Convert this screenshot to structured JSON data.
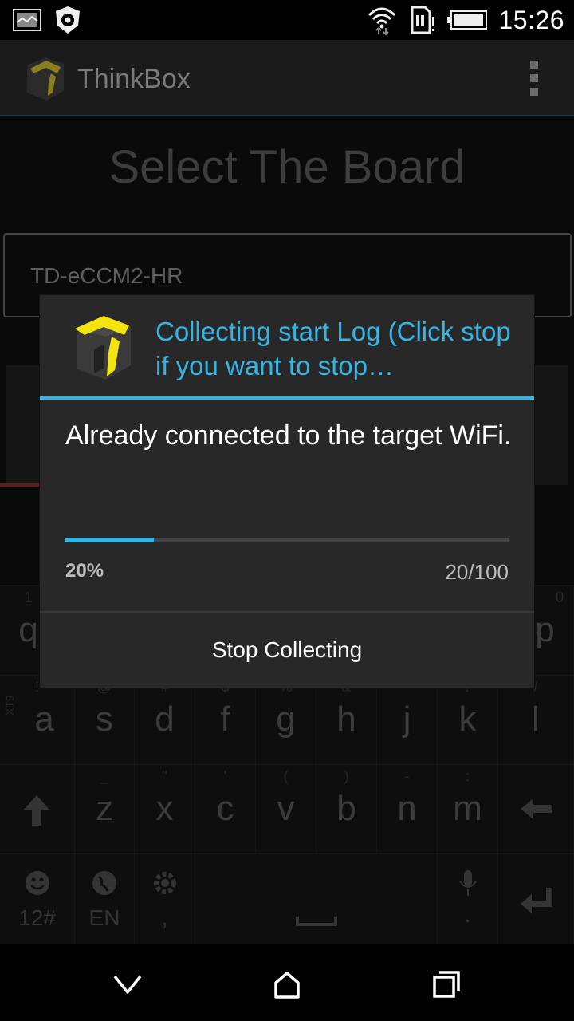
{
  "status_bar": {
    "time": "15:26",
    "left_icons": [
      "image-icon",
      "settings-notification-icon"
    ],
    "right_icons": [
      "wifi-icon",
      "sim-alert-icon",
      "battery-icon"
    ]
  },
  "action_bar": {
    "title": "ThinkBox",
    "overflow_icon": "overflow-menu-icon"
  },
  "background": {
    "page_title": "Select The Board",
    "board_value": "TD-eCCM2-HR"
  },
  "dialog": {
    "title": "Collecting start Log (Click stop if you want to stop…",
    "message": "Already connected to the target WiFi.",
    "progress_fraction": 0.2,
    "progress_percent": "20%",
    "progress_count": "20/100",
    "button_label": "Stop Collecting",
    "accent_color": "#33b5e5"
  },
  "keyboard": {
    "row1_visible": [
      {
        "ch": "q",
        "hint": "1"
      },
      {
        "ch": "p",
        "hint": "0"
      }
    ],
    "row2": [
      {
        "ch": "a",
        "hint": "!"
      },
      {
        "ch": "s",
        "hint": "@"
      },
      {
        "ch": "d",
        "hint": "#"
      },
      {
        "ch": "f",
        "hint": "$"
      },
      {
        "ch": "g",
        "hint": "%"
      },
      {
        "ch": "h",
        "hint": "&"
      },
      {
        "ch": "j",
        "hint": "*"
      },
      {
        "ch": "k",
        "hint": "?"
      },
      {
        "ch": "l",
        "hint": "/"
      }
    ],
    "side_label": "XT9",
    "row3": [
      {
        "ch": "z",
        "hint": "_"
      },
      {
        "ch": "x",
        "hint": "\""
      },
      {
        "ch": "c",
        "hint": "'"
      },
      {
        "ch": "v",
        "hint": "("
      },
      {
        "ch": "b",
        "hint": ")"
      },
      {
        "ch": "n",
        "hint": "-"
      },
      {
        "ch": "m",
        "hint": ":"
      }
    ],
    "row4": {
      "symbols_label": "12#",
      "language_label": "EN",
      "comma_label": ","
    }
  },
  "nav_bar": {
    "icons": [
      "back-icon",
      "home-icon",
      "recents-icon"
    ]
  }
}
